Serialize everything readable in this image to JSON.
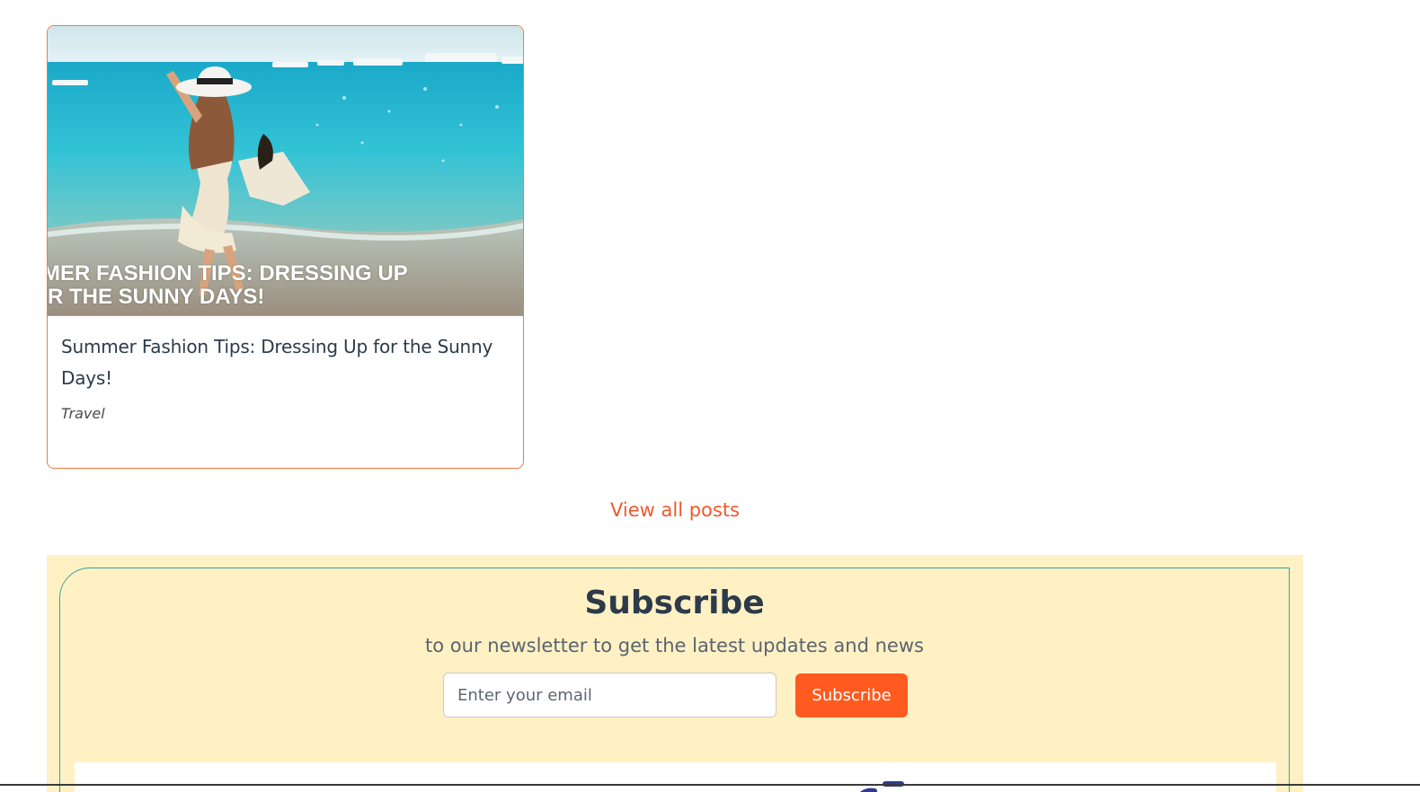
{
  "post": {
    "image_overlay_line1": "MMER FASHION TIPS: DRESSING UP",
    "image_overlay_line2": "R THE SUNNY DAYS!",
    "title": "Summer Fashion Tips: Dressing Up for the Sunny Days!",
    "category": "Travel"
  },
  "view_all_label": "View all posts",
  "subscribe": {
    "title": "Subscribe",
    "subtitle": "to our newsletter to get the latest updates and news",
    "email_placeholder": "Enter your email",
    "button_label": "Subscribe"
  },
  "colors": {
    "accent": "#ff5a1f",
    "link": "#ee5a2c",
    "card_border": "#f07a45",
    "section_bg": "#fff1c4",
    "box_border": "#3fa39a",
    "heading": "#2d3a4a"
  }
}
